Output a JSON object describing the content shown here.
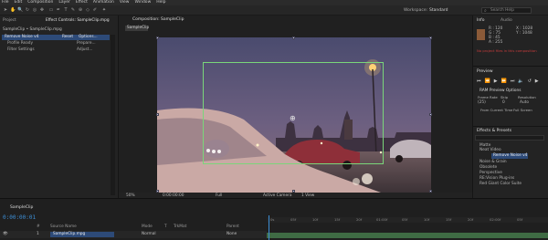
{
  "menu": [
    "File",
    "Edit",
    "Composition",
    "Layer",
    "Effect",
    "Animation",
    "View",
    "Window",
    "Help"
  ],
  "header": {
    "workspace_label": "Workspace:",
    "workspace_value": "Standard",
    "search_placeholder": "Search Help"
  },
  "left_panel": {
    "tabs": [
      "Project",
      "Effect Controls: SampleClip.mpg"
    ],
    "strip": "SampleClip • SampleClip.mpg",
    "effect": {
      "name": "Remove Noise v4",
      "reset": "Reset",
      "options": "Options...",
      "about": "About..."
    },
    "props": [
      {
        "name": "Profile Ready",
        "value": "Prepare..."
      },
      {
        "name": "Filter Settings",
        "value": "Adjust..."
      }
    ]
  },
  "viewer": {
    "tab": "Composition: SampleClip",
    "sub_tab": "SampleClip",
    "controls": {
      "zoom": "50%",
      "timecode": "0:00:00:00",
      "resolution": "Full",
      "camera": "Active Camera",
      "views": "1 View"
    }
  },
  "right": {
    "info_tabs": [
      "Info",
      "Audio"
    ],
    "info_lines": [
      "R : 120",
      "G : 75",
      "B : 45",
      "A : 255"
    ],
    "coord_lines": [
      "X : 1028",
      "Y : 1048"
    ],
    "status_line": "No project files in this composition",
    "preview_title": "Preview",
    "ram_label": "RAM Preview Options",
    "frame_rate_label": "Frame Rate",
    "skip_label": "Skip",
    "resolution_label": "Resolution",
    "frame_rate_val": "(25)",
    "skip_val": "0",
    "resolution_val": "Auto",
    "from_current": "From Current Time",
    "full_screen": "Full Screen",
    "effects_title": "Effects & Presets",
    "effects_items": [
      "Matte",
      "Noise & Grain",
      "Obsolete",
      "Perspective",
      "RE:Vision Plug-ins",
      "Red Giant Color Suite"
    ],
    "effects_selected": "Remove Noise v4",
    "effects_group": "Neat Video"
  },
  "timeline": {
    "tab": "SampleClip",
    "timecode": "0:00:00:01",
    "ruler": [
      "0s",
      "05f",
      "10f",
      "15f",
      "20f",
      "01:00f",
      "05f",
      "10f",
      "15f",
      "20f",
      "02:00f",
      "05f"
    ],
    "cols": [
      "#",
      "Source Name",
      "Mode",
      "T",
      "TrkMat",
      "Parent"
    ],
    "row": {
      "index": "1",
      "name": "SampleClip.mpg",
      "mode": "Normal",
      "parent": "None"
    }
  },
  "colors": {
    "accent": "#3d8fd6",
    "selection": "#2d4a78",
    "track": "#3f6b44",
    "safe": "#7ad67a",
    "warning": "#c43b3b"
  }
}
